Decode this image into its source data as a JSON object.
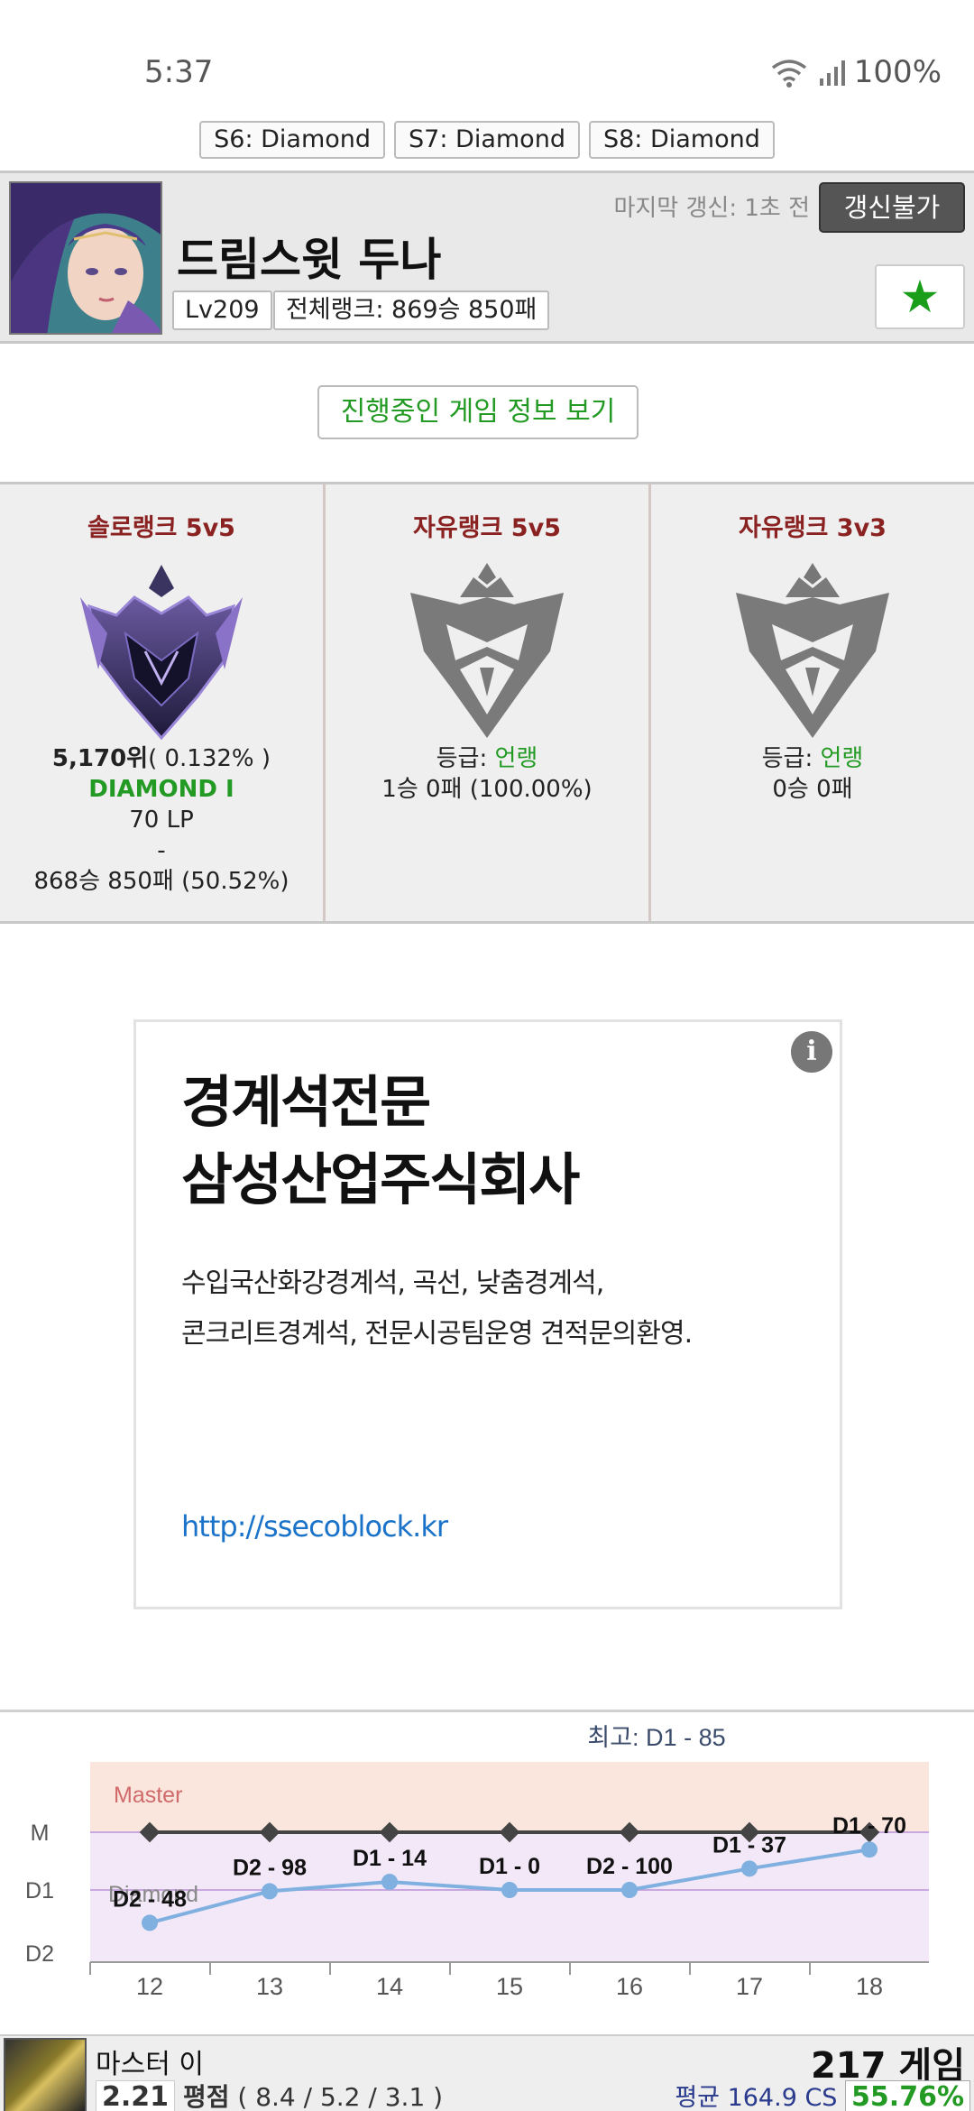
{
  "status_bar": {
    "time": "5:37",
    "battery": "100%"
  },
  "seasons": [
    "S6: Diamond",
    "S7: Diamond",
    "S8: Diamond"
  ],
  "profile": {
    "name": "드림스윗 두나",
    "level": "Lv209",
    "total_rank": "전체랭크: 869승 850패",
    "last_update": "마지막 갱신: 1초 전",
    "refresh_label": "갱신불가",
    "favorite_icon": "star-icon",
    "favorite_color": "#1a9e1a"
  },
  "ingame_button": "진행중인 게임 정보 보기",
  "ranks": [
    {
      "title": "솔로랭크 5v5",
      "emblem": "diamond-emblem",
      "rank_number": "5,170위",
      "rank_percent": "( 0.132% )",
      "tier": "DIAMOND I",
      "lp": "70 LP",
      "separator": "-",
      "record": "868승 850패 (50.52%)"
    },
    {
      "title": "자유랭크 5v5",
      "emblem": "unranked-emblem",
      "grade_label": "등급:",
      "grade_value": "언랭",
      "record": "1승 0패 (100.00%)"
    },
    {
      "title": "자유랭크 3v3",
      "emblem": "unranked-emblem",
      "grade_label": "등급:",
      "grade_value": "언랭",
      "record": "0승 0패"
    }
  ],
  "ad": {
    "headline_1": "경계석전문",
    "headline_2": "삼성산업주식회사",
    "body_1": "수입국산화강경계석, 곡선, 낮춤경계석,",
    "body_2": "콘크리트경계석, 전문시공팀운영 견적문의환영.",
    "url": "http://ssecoblock.kr",
    "info_icon": "info-icon"
  },
  "chart_data": {
    "type": "line",
    "title": "최고: D1 - 85",
    "x": [
      12,
      13,
      14,
      15,
      16,
      17,
      18
    ],
    "y_tiers": [
      "M",
      "D1",
      "D2"
    ],
    "band_labels": [
      "Master",
      "Diamond"
    ],
    "series": [
      {
        "values": [
          48,
          98,
          14,
          0,
          100,
          37,
          70
        ],
        "tiers": [
          "D2",
          "D2",
          "D1",
          "D1",
          "D2",
          "D1",
          "D1"
        ],
        "labels": [
          "D2 - 48",
          "D2 - 98",
          "D1 - 14",
          "D1 - 0",
          "D2 - 100",
          "D1 - 37",
          "D1 - 70"
        ],
        "color": "#7fb0e0"
      },
      {
        "values": [
          0,
          0,
          0,
          0,
          0,
          0,
          0
        ],
        "tiers": [
          "M",
          "M",
          "M",
          "M",
          "M",
          "M",
          "M"
        ],
        "color": "#444444"
      }
    ]
  },
  "recent": {
    "champion_title": "마스터 이",
    "kda_score": "2.21",
    "kda_label": "평점",
    "kda_detail": "( 8.4 / 5.2 / 3.1 )",
    "games": "217 게임",
    "avg_cs": "평균 164.9 CS",
    "winrate": "55.76%"
  }
}
